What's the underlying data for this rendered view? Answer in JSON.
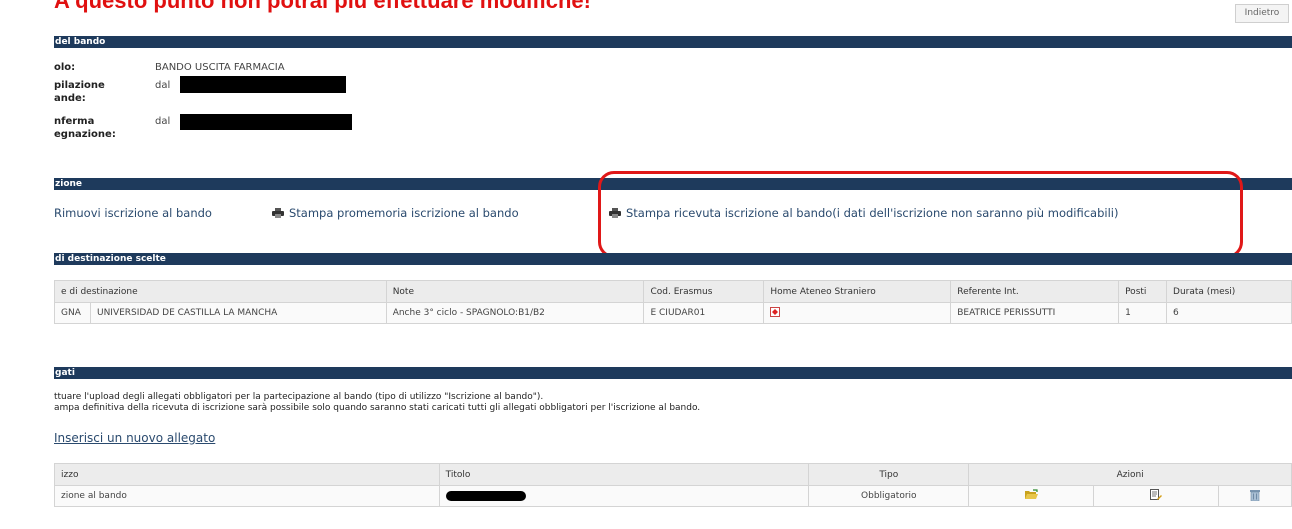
{
  "warning": "A questo punto non potrai più effettuare modifiche!",
  "back_button": "Indietro",
  "sections": {
    "bando": "del bando",
    "iscrizione": "zione",
    "destinazioni": "di destinazione scelte",
    "allegati": "gati"
  },
  "bando": {
    "titolo_label": "olo:",
    "titolo_value": "BANDO USCITA FARMACIA",
    "compilazione_label_1": "pilazione",
    "compilazione_label_2": "ande:",
    "compilazione_value": "dal",
    "conferma_label_1": "nferma",
    "conferma_label_2": "egnazione:",
    "conferma_value": "dal"
  },
  "actions": {
    "remove": "Rimuovi iscrizione al bando",
    "print_reminder": "Stampa promemoria iscrizione al bando",
    "print_receipt": "Stampa ricevuta iscrizione al bando(i dati dell'iscrizione non saranno più modificabili)"
  },
  "destinations": {
    "headers": [
      "e di destinazione",
      "Note",
      "Cod. Erasmus",
      "Home Ateneo Straniero",
      "Referente Int.",
      "Posti",
      "Durata (mesi)"
    ],
    "row": {
      "country": "GNA",
      "university": "UNIVERSIDAD DE CASTILLA LA MANCHA",
      "note": "Anche 3° ciclo - SPAGNOLO:B1/B2",
      "erasmus": "E CIUDAR01",
      "referente": "BEATRICE PERISSUTTI",
      "posti": "1",
      "durata": "6"
    }
  },
  "allegati": {
    "info_1": "ttuare l'upload degli allegati obbligatori per la partecipazione al bando (tipo di utilizzo \"Iscrizione al bando\").",
    "info_2": "ampa definitiva della ricevuta di iscrizione sarà possibile solo quando saranno stati caricati tutti gli allegati obbligatori per l'iscrizione al bando.",
    "add_link": "Inserisci un nuovo allegato",
    "headers": [
      "izzo",
      "Titolo",
      "Tipo",
      "Azioni"
    ],
    "row": {
      "utilizzo": "zione al bando",
      "tipo": "Obbligatorio"
    }
  },
  "colors": {
    "warning": "#e01010",
    "bar": "#1e3a5c",
    "highlight": "#e01818",
    "link": "#2a4a6e"
  }
}
